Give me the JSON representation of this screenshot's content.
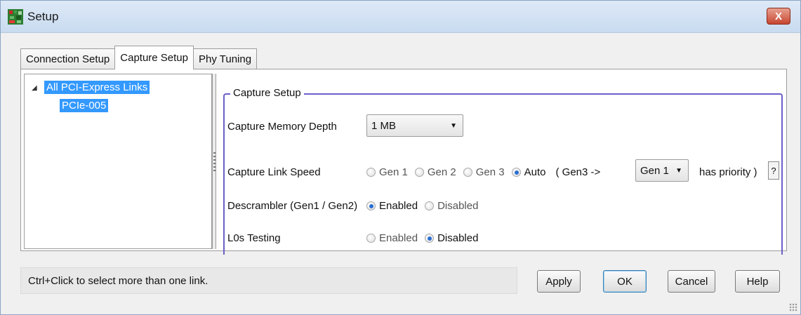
{
  "window": {
    "title": "Setup",
    "close_label": "X"
  },
  "tabs": [
    {
      "label": "Connection Setup",
      "active": false
    },
    {
      "label": "Capture Setup",
      "active": true
    },
    {
      "label": "Phy Tuning",
      "active": false
    }
  ],
  "tree": {
    "root": "All PCI-Express Links",
    "child": "PCIe-005"
  },
  "capture_setup": {
    "group_title": "Capture Setup",
    "memory_depth": {
      "label": "Capture Memory Depth",
      "value": "1 MB"
    },
    "link_speed": {
      "label": "Capture Link Speed",
      "options": [
        "Gen 1",
        "Gen 2",
        "Gen 3",
        "Auto"
      ],
      "selected": "Auto",
      "gen3_prefix": "( Gen3 ->",
      "priority_value": "Gen 1",
      "priority_suffix": "has priority )",
      "help": "?"
    },
    "descrambler": {
      "label": "Descrambler (Gen1 / Gen2)",
      "options": [
        "Enabled",
        "Disabled"
      ],
      "selected": "Enabled"
    },
    "l0s_testing": {
      "label": "L0s Testing",
      "options": [
        "Enabled",
        "Disabled"
      ],
      "selected": "Disabled"
    }
  },
  "status_text": "Ctrl+Click to select more than one link.",
  "buttons": {
    "apply": "Apply",
    "ok": "OK",
    "cancel": "Cancel",
    "help": "Help"
  },
  "colors": {
    "selection": "#3399ff",
    "group_border": "#6a60c8",
    "close": "#c64731"
  }
}
